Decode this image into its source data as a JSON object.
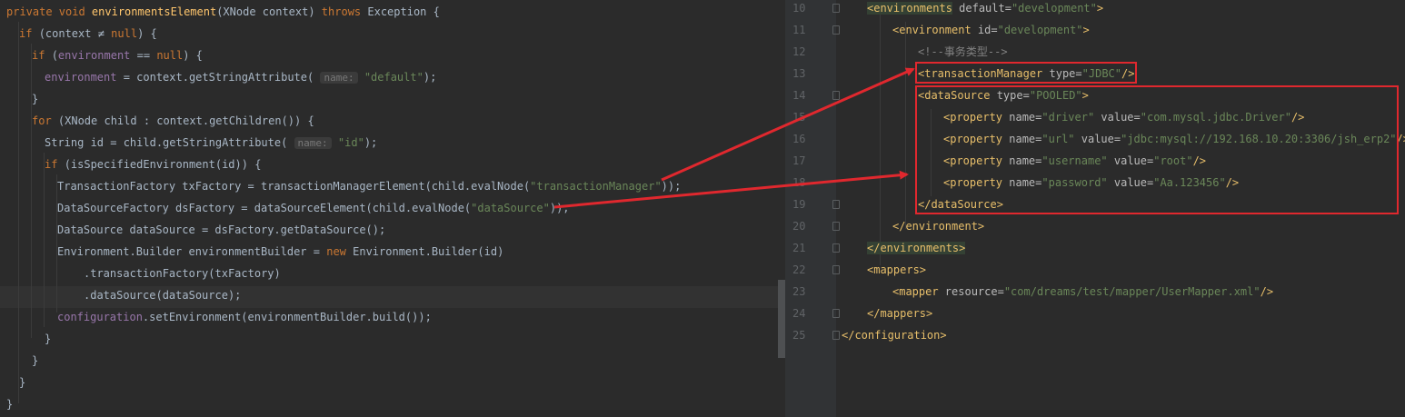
{
  "left_editor": {
    "lines": [
      [
        [
          "kw",
          "private void "
        ],
        [
          "fn",
          "environmentsElement"
        ],
        [
          "p",
          "(XNode context) "
        ],
        [
          "kw",
          "throws "
        ],
        [
          "p",
          "Exception {"
        ]
      ],
      [
        [
          "kw",
          "if "
        ],
        [
          "p",
          "(context ≠ "
        ],
        [
          "kw",
          "null"
        ],
        [
          "p",
          ") {"
        ]
      ],
      [
        [
          "kw",
          "if "
        ],
        [
          "p",
          "("
        ],
        [
          "field",
          "environment"
        ],
        [
          "p",
          " == "
        ],
        [
          "kw",
          "null"
        ],
        [
          "p",
          ") {"
        ]
      ],
      [
        [
          "field",
          "environment"
        ],
        [
          "p",
          " = context.getStringAttribute( "
        ],
        [
          "hint",
          "name:"
        ],
        [
          "p",
          " "
        ],
        [
          "str",
          "\"default\""
        ],
        [
          "p",
          ");"
        ]
      ],
      [
        [
          "p",
          "}"
        ]
      ],
      [
        [
          "kw",
          "for "
        ],
        [
          "p",
          "(XNode child : context.getChildren()) {"
        ]
      ],
      [
        [
          "p",
          "String id = child.getStringAttribute( "
        ],
        [
          "hint",
          "name:"
        ],
        [
          "p",
          " "
        ],
        [
          "str",
          "\"id\""
        ],
        [
          "p",
          ");"
        ]
      ],
      [
        [
          "kw",
          "if "
        ],
        [
          "p",
          "(isSpecifiedEnvironment(id)) {"
        ]
      ],
      [
        [
          "p",
          "TransactionFactory txFactory = transactionManagerElement(child.evalNode("
        ],
        [
          "str",
          "\"transactionManager\""
        ],
        [
          "p",
          "));"
        ]
      ],
      [
        [
          "p",
          "DataSourceFactory dsFactory = dataSourceElement(child.evalNode("
        ],
        [
          "str",
          "\"dataSource\""
        ],
        [
          "p",
          "));"
        ]
      ],
      [
        [
          "p",
          "DataSource dataSource = dsFactory.getDataSource();"
        ]
      ],
      [
        [
          "p",
          "Environment.Builder environmentBuilder = "
        ],
        [
          "kw",
          "new "
        ],
        [
          "p",
          "Environment.Builder(id)"
        ]
      ],
      [
        [
          "p",
          ".transactionFactory(txFactory)"
        ]
      ],
      [
        [
          "p",
          ".dataSource(dataSource);"
        ]
      ],
      [
        [
          "field",
          "configuration"
        ],
        [
          "p",
          ".setEnvironment(environmentBuilder.build());"
        ]
      ],
      [
        [
          "p",
          "}"
        ]
      ],
      [
        [
          "p",
          "}"
        ]
      ],
      [
        [
          "p",
          "}"
        ]
      ],
      [
        [
          "p",
          "}"
        ]
      ]
    ]
  },
  "right_editor": {
    "line_numbers": [
      "10",
      "11",
      "12",
      "13",
      "14",
      "15",
      "16",
      "17",
      "18",
      "19",
      "20",
      "21",
      "22",
      "23",
      "24",
      "25"
    ],
    "lines": [
      [
        [
          "sel",
          "<environments"
        ],
        [
          "attr",
          " default="
        ],
        [
          "str",
          "\"development\""
        ],
        [
          "tag",
          ">"
        ]
      ],
      [
        [
          "tag",
          "<environment"
        ],
        [
          "attr",
          " id="
        ],
        [
          "str",
          "\"development\""
        ],
        [
          "tag",
          ">"
        ]
      ],
      [
        [
          "comment",
          "<!--事务类型-->"
        ]
      ],
      [
        [
          "tag",
          "<transactionManager"
        ],
        [
          "attr",
          " type="
        ],
        [
          "str",
          "\"JDBC\""
        ],
        [
          "tag",
          "/>"
        ]
      ],
      [
        [
          "tag",
          "<dataSource"
        ],
        [
          "attr",
          " type="
        ],
        [
          "str",
          "\"POOLED\""
        ],
        [
          "tag",
          ">"
        ]
      ],
      [
        [
          "tag",
          "<property"
        ],
        [
          "attr",
          " name="
        ],
        [
          "str",
          "\"driver\""
        ],
        [
          "attr",
          " value="
        ],
        [
          "str",
          "\"com.mysql.jdbc.Driver\""
        ],
        [
          "tag",
          "/>"
        ]
      ],
      [
        [
          "tag",
          "<property"
        ],
        [
          "attr",
          " name="
        ],
        [
          "str",
          "\"url\""
        ],
        [
          "attr",
          " value="
        ],
        [
          "str",
          "\"jdbc:mysql://192.168.10.20:3306/jsh_erp2\""
        ],
        [
          "tag",
          "/>"
        ]
      ],
      [
        [
          "tag",
          "<property"
        ],
        [
          "attr",
          " name="
        ],
        [
          "str",
          "\"username\""
        ],
        [
          "attr",
          " value="
        ],
        [
          "str",
          "\"root\""
        ],
        [
          "tag",
          "/>"
        ]
      ],
      [
        [
          "tag",
          "<property"
        ],
        [
          "attr",
          " name="
        ],
        [
          "str",
          "\"password\""
        ],
        [
          "attr",
          " value="
        ],
        [
          "str",
          "\"Aa.123456\""
        ],
        [
          "tag",
          "/>"
        ]
      ],
      [
        [
          "tag",
          "</dataSource>"
        ]
      ],
      [
        [
          "tag",
          "</environment>"
        ]
      ],
      [
        [
          "sel",
          "</environments>"
        ]
      ],
      [
        [
          "tag",
          "<mappers>"
        ]
      ],
      [
        [
          "tag",
          "<mapper"
        ],
        [
          "attr",
          " resource="
        ],
        [
          "str",
          "\"com/dreams/test/mapper/UserMapper.xml\""
        ],
        [
          "tag",
          "/>"
        ]
      ],
      [
        [
          "tag",
          "</mappers>"
        ]
      ],
      [
        [
          "tag",
          "</configuration>"
        ]
      ]
    ]
  },
  "colors": {
    "background": "#2b2b2b",
    "keyword": "#cc7832",
    "string": "#6a8759",
    "field": "#9876aa",
    "method": "#ffc66d",
    "xml_tag": "#e8bf6a",
    "annotation_red": "#e0282e"
  }
}
